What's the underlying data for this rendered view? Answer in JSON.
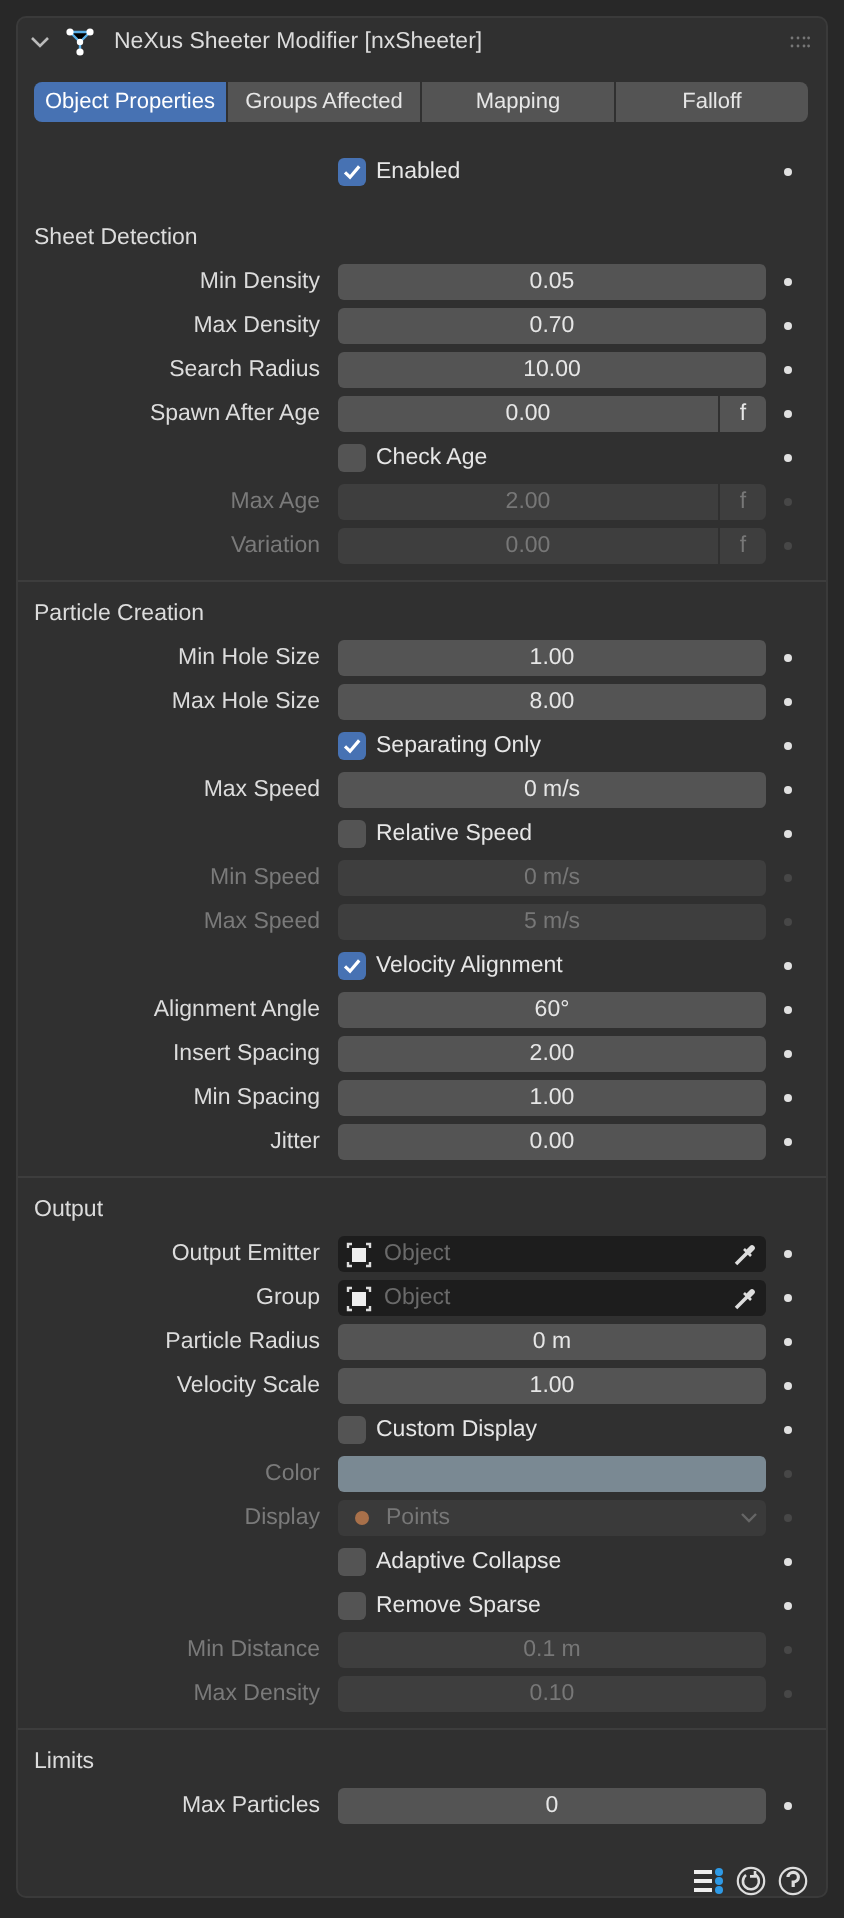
{
  "panel": {
    "title": "NeXus Sheeter Modifier [nxSheeter]",
    "expanded": true
  },
  "tabs": [
    {
      "label": "Object Properties",
      "selected": true
    },
    {
      "label": "Groups Affected",
      "selected": false
    },
    {
      "label": "Mapping",
      "selected": false
    },
    {
      "label": "Falloff",
      "selected": false
    }
  ],
  "sections": [
    {
      "rows": [
        {
          "kind": "check",
          "label": "Enabled",
          "checked": true,
          "disabled": false
        }
      ]
    },
    {
      "title": "Sheet Detection",
      "rows": [
        {
          "kind": "number",
          "label": "Min Density",
          "value": "0.05",
          "disabled": false
        },
        {
          "kind": "number",
          "label": "Max Density",
          "value": "0.70",
          "disabled": false
        },
        {
          "kind": "number",
          "label": "Search Radius",
          "value": "10.00",
          "disabled": false
        },
        {
          "kind": "number",
          "label": "Spawn After Age",
          "value": "0.00",
          "unit_button": "f",
          "disabled": false
        },
        {
          "kind": "check",
          "label": "Check Age",
          "checked": false,
          "disabled": false
        },
        {
          "kind": "number",
          "label": "Max Age",
          "value": "2.00",
          "unit_button": "f",
          "disabled": true
        },
        {
          "kind": "number",
          "label": "Variation",
          "value": "0.00",
          "unit_button": "f",
          "disabled": true
        }
      ]
    },
    {
      "title": "Particle Creation",
      "rows": [
        {
          "kind": "number",
          "label": "Min Hole Size",
          "value": "1.00",
          "disabled": false
        },
        {
          "kind": "number",
          "label": "Max Hole Size",
          "value": "8.00",
          "disabled": false
        },
        {
          "kind": "check",
          "label": "Separating Only",
          "checked": true,
          "disabled": false
        },
        {
          "kind": "number",
          "label": "Max Speed",
          "value": "0 m/s",
          "disabled": false
        },
        {
          "kind": "check",
          "label": "Relative Speed",
          "checked": false,
          "disabled": false
        },
        {
          "kind": "number",
          "label": "Min Speed",
          "value": "0 m/s",
          "disabled": true
        },
        {
          "kind": "number",
          "label": "Max Speed",
          "value": "5 m/s",
          "disabled": true
        },
        {
          "kind": "check",
          "label": "Velocity Alignment",
          "checked": true,
          "disabled": false
        },
        {
          "kind": "number",
          "label": "Alignment Angle",
          "value": "60°",
          "disabled": false
        },
        {
          "kind": "number",
          "label": "Insert Spacing",
          "value": "2.00",
          "disabled": false
        },
        {
          "kind": "number",
          "label": "Min Spacing",
          "value": "1.00",
          "disabled": false
        },
        {
          "kind": "number",
          "label": "Jitter",
          "value": "0.00",
          "disabled": false
        }
      ]
    },
    {
      "title": "Output",
      "rows": [
        {
          "kind": "object",
          "label": "Output Emitter",
          "placeholder": "Object"
        },
        {
          "kind": "object",
          "label": "Group",
          "placeholder": "Object"
        },
        {
          "kind": "number",
          "label": "Particle Radius",
          "value": "0 m",
          "disabled": false
        },
        {
          "kind": "number",
          "label": "Velocity Scale",
          "value": "1.00",
          "disabled": false
        },
        {
          "kind": "check",
          "label": "Custom Display",
          "checked": false,
          "disabled": false
        },
        {
          "kind": "color",
          "label": "Color",
          "color": "#8595a0",
          "disabled": true
        },
        {
          "kind": "enum",
          "label": "Display",
          "value": "Points",
          "disabled": true
        },
        {
          "kind": "check",
          "label": "Adaptive Collapse",
          "checked": false,
          "disabled": false
        },
        {
          "kind": "check",
          "label": "Remove Sparse",
          "checked": false,
          "disabled": false
        },
        {
          "kind": "number",
          "label": "Min Distance",
          "value": "0.1 m",
          "disabled": true
        },
        {
          "kind": "number",
          "label": "Max Density",
          "value": "0.10",
          "disabled": true
        }
      ]
    },
    {
      "title": "Limits",
      "rows": [
        {
          "kind": "number",
          "label": "Max Particles",
          "value": "0",
          "disabled": false
        }
      ]
    }
  ]
}
